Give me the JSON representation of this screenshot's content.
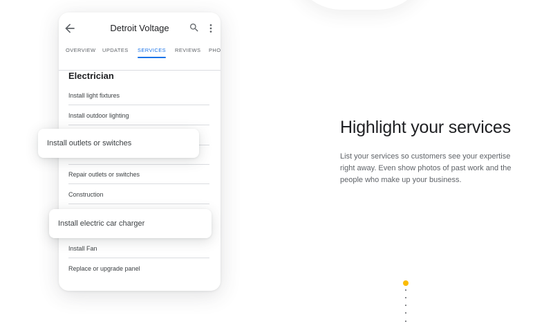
{
  "app": {
    "title": "Detroit Voltage",
    "icons": {
      "back": "arrow-back-icon",
      "search": "search-icon",
      "more": "more-vert-icon"
    }
  },
  "tabs": [
    {
      "label": "OVERVIEW",
      "active": false
    },
    {
      "label": "UPDATES",
      "active": false
    },
    {
      "label": "SERVICES",
      "active": true
    },
    {
      "label": "REVIEWS",
      "active": false
    },
    {
      "label": "PHO",
      "active": false
    }
  ],
  "services": {
    "heading": "Electrician",
    "items": [
      "Install light fixtures",
      "Install outdoor lighting",
      "",
      "",
      "Repair outlets or switches",
      "Construction",
      "",
      "Install Fan",
      "Replace or upgrade panel"
    ]
  },
  "floating": {
    "card1": "Install outlets or switches",
    "card2": "Install electric car charger"
  },
  "hero": {
    "title": "Highlight your services",
    "description": "List your services so customers see your expertise right away. Even show photos of past work and the people who make up your business."
  },
  "pager": {
    "active_index": 0,
    "count": 6,
    "active_color": "#fbbc04"
  },
  "colors": {
    "accent": "#1a73e8",
    "text": "#202124",
    "muted": "#5f6368"
  }
}
